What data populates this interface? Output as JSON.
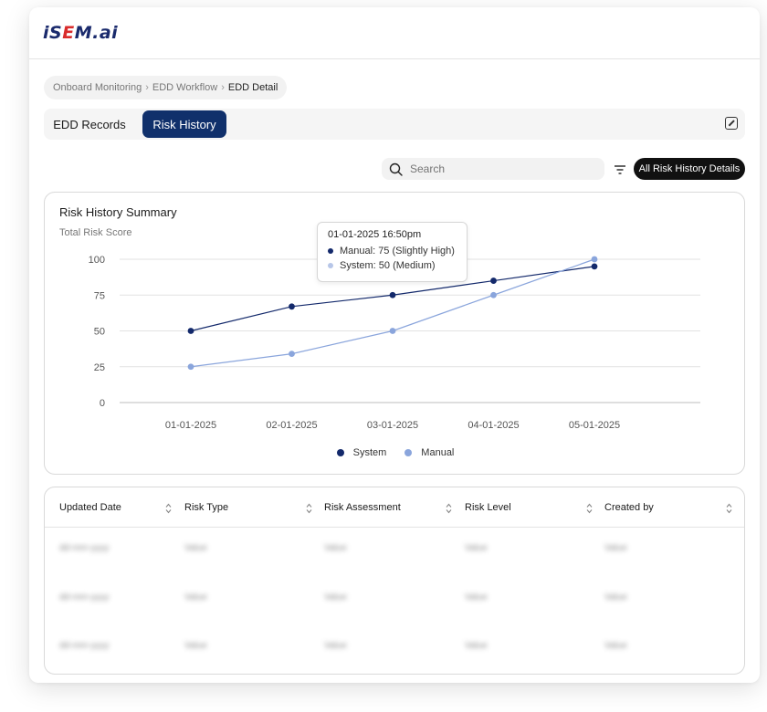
{
  "app": {
    "logo_part1": "iS",
    "logo_part2": "E",
    "logo_part3": "M.ai"
  },
  "breadcrumb": {
    "items": [
      "Onboard Monitoring",
      "EDD Workflow",
      "EDD Detail"
    ],
    "separator": "›"
  },
  "tabs": [
    {
      "label": "EDD Records",
      "active": false
    },
    {
      "label": "Risk History",
      "active": true
    }
  ],
  "search": {
    "placeholder": "Search"
  },
  "toolbar": {
    "all_details_label": "All Risk History Details"
  },
  "chart_card": {
    "title": "Risk History Summary",
    "subtitle": "Total Risk Score",
    "tooltip": {
      "title": "01-01-2025 16:50pm",
      "manual": "Manual: 75 (Slightly High)",
      "system": "System: 50 (Medium)"
    }
  },
  "chart_data": {
    "type": "line",
    "x": [
      "01-01-2025",
      "02-01-2025",
      "03-01-2025",
      "04-01-2025",
      "05-01-2025"
    ],
    "yticks": [
      0,
      25,
      50,
      75,
      100
    ],
    "ylim": [
      0,
      100
    ],
    "grid": true,
    "legend_position": "bottom-center",
    "series": [
      {
        "name": "System",
        "color": "#13296b",
        "values": [
          50,
          67,
          75,
          85,
          95
        ]
      },
      {
        "name": "Manual",
        "color": "#8aa5dc",
        "values": [
          25,
          34,
          50,
          75,
          100
        ]
      }
    ]
  },
  "table": {
    "columns": [
      "Updated Date",
      "Risk Type",
      "Risk Assessment",
      "Risk Level",
      "Created by"
    ],
    "rows": [
      [
        "dd-mm-yyyy",
        "Value",
        "Value",
        "Value",
        "Value"
      ],
      [
        "dd-mm-yyyy",
        "Value",
        "Value",
        "Value",
        "Value"
      ],
      [
        "dd-mm-yyyy",
        "Value",
        "Value",
        "Value",
        "Value"
      ]
    ]
  }
}
